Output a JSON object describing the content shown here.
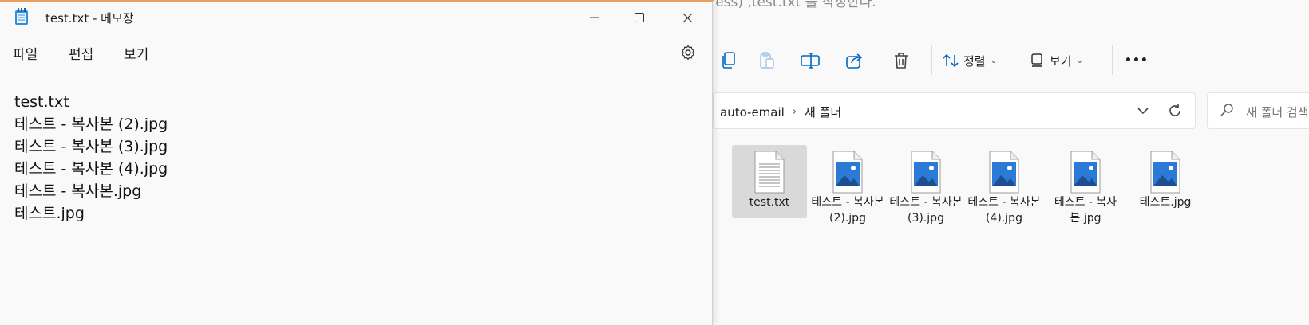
{
  "explorer": {
    "background_text": "ddress) ,test.txt 를 작성한다.",
    "toolbar": {
      "icons": [
        "copy-icon",
        "paste-icon",
        "rename-icon",
        "share-icon",
        "delete-icon"
      ],
      "sort_label": "정렬",
      "view_label": "보기",
      "more_label": "•••"
    },
    "address": {
      "crumbs": [
        "auto-email",
        "새 폴더"
      ]
    },
    "search": {
      "placeholder": "새 폴더 검색"
    },
    "files": [
      {
        "name": "test.txt",
        "type": "text",
        "selected": true
      },
      {
        "name": "테스트 - 복사본 (2).jpg",
        "type": "image",
        "selected": false
      },
      {
        "name": "테스트 - 복사본 (3).jpg",
        "type": "image",
        "selected": false
      },
      {
        "name": "테스트 - 복사본 (4).jpg",
        "type": "image",
        "selected": false
      },
      {
        "name": "테스트 - 복사본.jpg",
        "type": "image",
        "selected": false
      },
      {
        "name": "테스트.jpg",
        "type": "image",
        "selected": false
      }
    ],
    "colors": {
      "image_blue": "#2b7bd6",
      "accent": "#0067c0"
    }
  },
  "notepad": {
    "title": "test.txt - 메모장",
    "menu": {
      "file": "파일",
      "edit": "편집",
      "view": "보기"
    },
    "lines": [
      "test.txt",
      "테스트 - 복사본 (2).jpg",
      "테스트 - 복사본 (3).jpg",
      "테스트 - 복사본 (4).jpg",
      "테스트 - 복사본.jpg",
      "테스트.jpg"
    ],
    "colors": {
      "title_accent": "#e9a05f"
    }
  }
}
